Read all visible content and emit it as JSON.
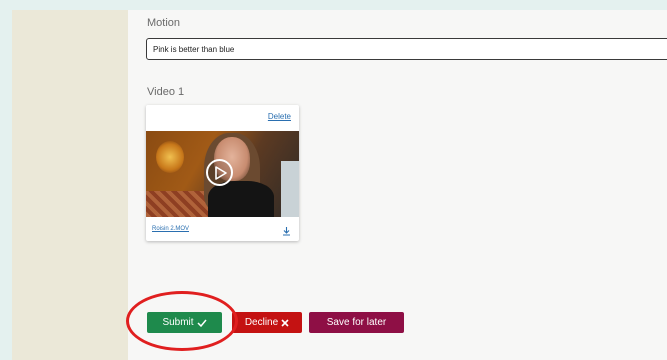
{
  "motion": {
    "label": "Motion",
    "value": "Pink is better than blue"
  },
  "video": {
    "label": "Video 1",
    "delete_label": "Delete",
    "filename": "Roisin 2.MOV"
  },
  "actions": {
    "submit": "Submit",
    "decline": "Decline",
    "later": "Save for later"
  },
  "colors": {
    "submit": "#1e8a4c",
    "decline": "#c41212",
    "later": "#8e0f45",
    "highlight": "#e01f1f"
  },
  "icons": [
    "play-icon",
    "download-icon",
    "check-icon",
    "x-icon"
  ]
}
